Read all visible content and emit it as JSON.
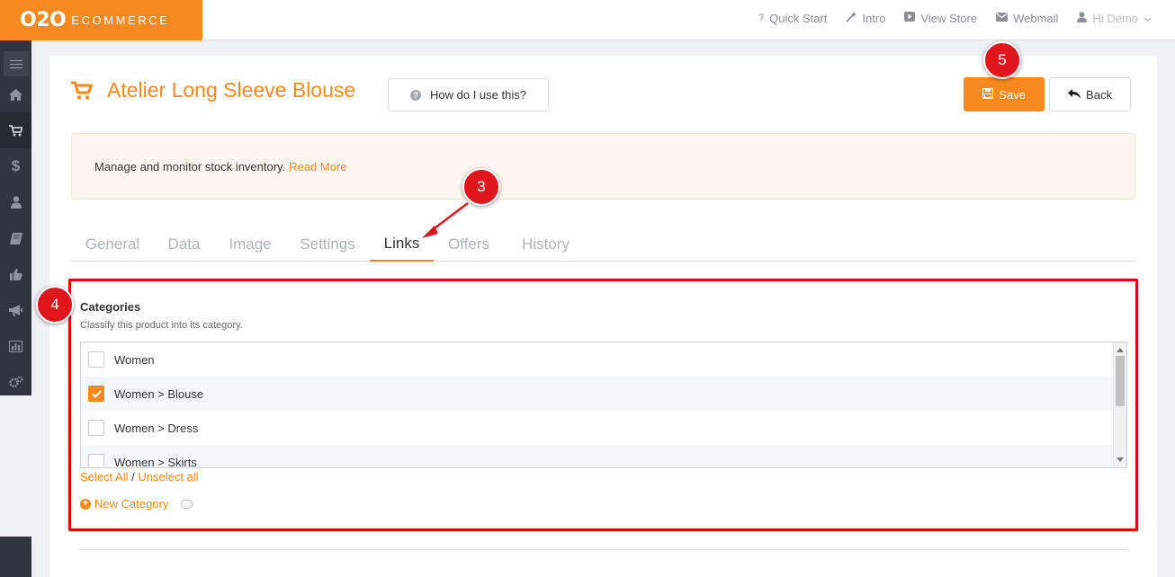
{
  "header": {
    "logo_mark": "O2O",
    "logo_word": "ECOMMERCE",
    "nav": [
      {
        "icon": "question-icon",
        "label": "Quick Start"
      },
      {
        "icon": "magic-wand-icon",
        "label": "Intro"
      },
      {
        "icon": "play-icon",
        "label": "View Store"
      },
      {
        "icon": "envelope-icon",
        "label": "Webmail"
      },
      {
        "icon": "user-icon",
        "label": "Hi Demo"
      }
    ]
  },
  "sidebar": {
    "icons": [
      "menu-icon",
      "home-icon",
      "cart-icon",
      "dollar-icon",
      "user-icon",
      "book-icon",
      "thumbs-up-icon",
      "megaphone-icon",
      "chart-icon",
      "gears-icon",
      "comment-icon"
    ],
    "active": "cart-icon"
  },
  "page": {
    "title": "Atelier Long Sleeve Blouse",
    "help_label": "How do I use this?",
    "save_label": "Save",
    "back_label": "Back"
  },
  "notice": {
    "text": "Manage and monitor stock inventory.",
    "link": "Read More"
  },
  "tabs": [
    {
      "label": "General",
      "active": false
    },
    {
      "label": "Data",
      "active": false
    },
    {
      "label": "Image",
      "active": false
    },
    {
      "label": "Settings",
      "active": false
    },
    {
      "label": "Links",
      "active": true
    },
    {
      "label": "Offers",
      "active": false
    },
    {
      "label": "History",
      "active": false
    }
  ],
  "categories": {
    "title": "Categories",
    "subtitle": "Classify this product into its category.",
    "items": [
      {
        "label": "Women",
        "checked": false
      },
      {
        "label": "Women > Blouse",
        "checked": true
      },
      {
        "label": "Women > Dress",
        "checked": false
      },
      {
        "label": "Women > Skirts",
        "checked": false
      }
    ],
    "select_all": "Select All",
    "separator": "/",
    "unselect_all": "Unselect all",
    "new_category": "New Category"
  },
  "annotations": {
    "step3": "3",
    "step4": "4",
    "step5": "5"
  },
  "colors": {
    "accent": "#f7891e",
    "annotation_red": "#e0161d",
    "sidebar": "#2f3640"
  }
}
